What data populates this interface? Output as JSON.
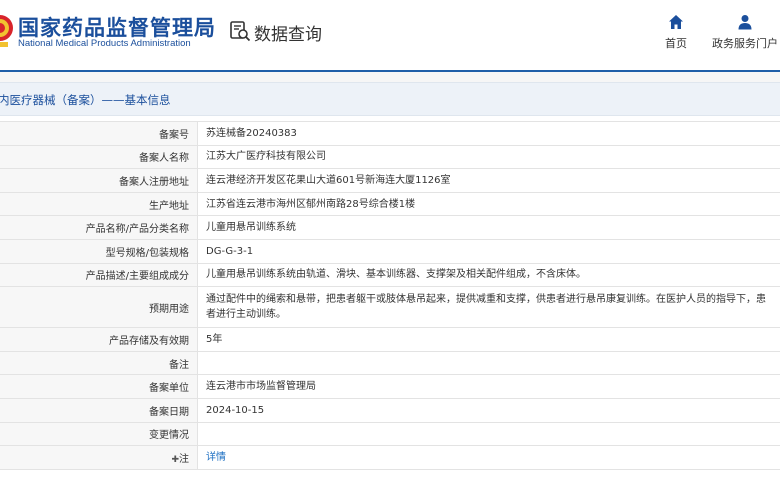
{
  "header": {
    "brand_cn": "国家药品监督管理局",
    "brand_en": "National Medical Products Administration",
    "page_title": "数据查询",
    "nav": [
      {
        "label": "首页",
        "icon": "home-icon"
      },
      {
        "label": "政务服务门户",
        "icon": "user-icon"
      }
    ],
    "brand_color": "#1b4f9c"
  },
  "section": {
    "title": "内医疗器械（备案）——基本信息"
  },
  "records": [
    {
      "label": "备案号",
      "value": "苏连械备20240383"
    },
    {
      "label": "备案人名称",
      "value": "江苏大广医疗科技有限公司"
    },
    {
      "label": "备案人注册地址",
      "value": "连云港经济开发区花果山大道601号新海连大厦1126室"
    },
    {
      "label": "生产地址",
      "value": "江苏省连云港市海州区郁州南路28号综合楼1楼"
    },
    {
      "label": "产品名称/产品分类名称",
      "value": "儿童用悬吊训练系统"
    },
    {
      "label": "型号规格/包装规格",
      "value": "DG-G-3-1"
    },
    {
      "label": "产品描述/主要组成成分",
      "value": "儿童用悬吊训练系统由轨道、滑块、基本训练器、支撑架及相关配件组成，不含床体。"
    },
    {
      "label": "预期用途",
      "value": "通过配件中的绳索和悬带，把患者躯干或肢体悬吊起来，提供减重和支撑，供患者进行悬吊康复训练。在医护人员的指导下，患者进行主动训练。"
    },
    {
      "label": "产品存储及有效期",
      "value": "5年"
    },
    {
      "label": "备注",
      "value": ""
    },
    {
      "label": "备案单位",
      "value": "连云港市市场监督管理局"
    },
    {
      "label": "备案日期",
      "value": "2024-10-15"
    },
    {
      "label": "变更情况",
      "value": ""
    },
    {
      "label": "注",
      "value": "详情"
    }
  ]
}
